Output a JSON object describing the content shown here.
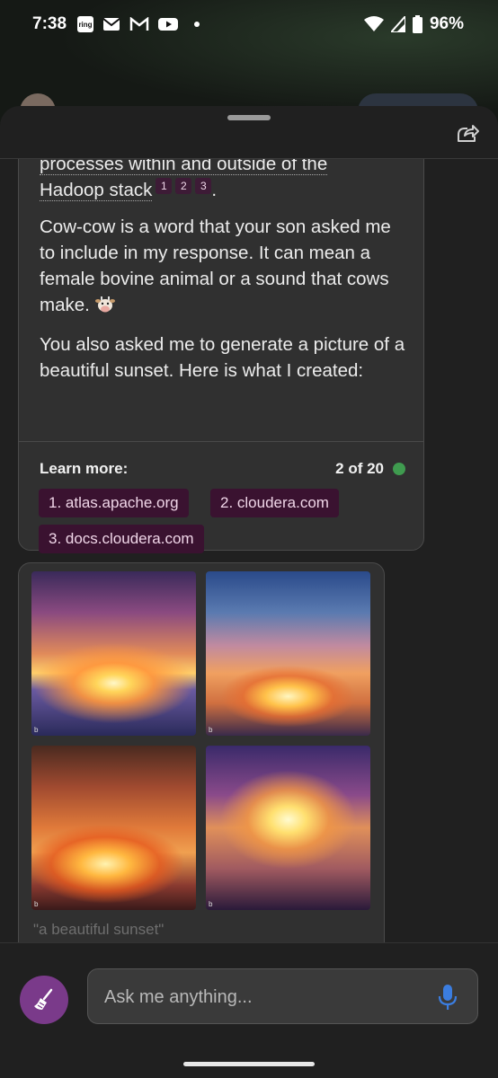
{
  "status_bar": {
    "time": "7:38",
    "left_icons": [
      "ring-icon",
      "mail-icon",
      "gmail-icon",
      "youtube-icon",
      "dot-icon"
    ],
    "ring_label": "ring",
    "battery": "96%"
  },
  "message": {
    "p0_line1": "processes within and outside of the",
    "p0_line2": "Hadoop stack",
    "citations": [
      "1",
      "2",
      "3"
    ],
    "p0_end": ".",
    "p1": "Cow-cow is a word that your son asked me to include in my response. It can mean a female bovine animal or a sound that cows make.",
    "p2": "You also asked me to generate a picture of a beautiful sunset. Here is what I created:"
  },
  "learn_more": {
    "label": "Learn more:",
    "counter": "2 of 20",
    "links": [
      "1. atlas.apache.org",
      "2. cloudera.com",
      "3. docs.cloudera.com"
    ]
  },
  "images": {
    "caption": "\"a beautiful sunset\"",
    "count": 4,
    "badge": "b"
  },
  "input": {
    "placeholder": "Ask me anything..."
  },
  "colors": {
    "citation_bg": "#3d1b36",
    "link_bg": "#3a1230",
    "counter_dot": "#3f9b4f",
    "broom_button": "#7a3a8a",
    "mic": "#3b7de0"
  }
}
